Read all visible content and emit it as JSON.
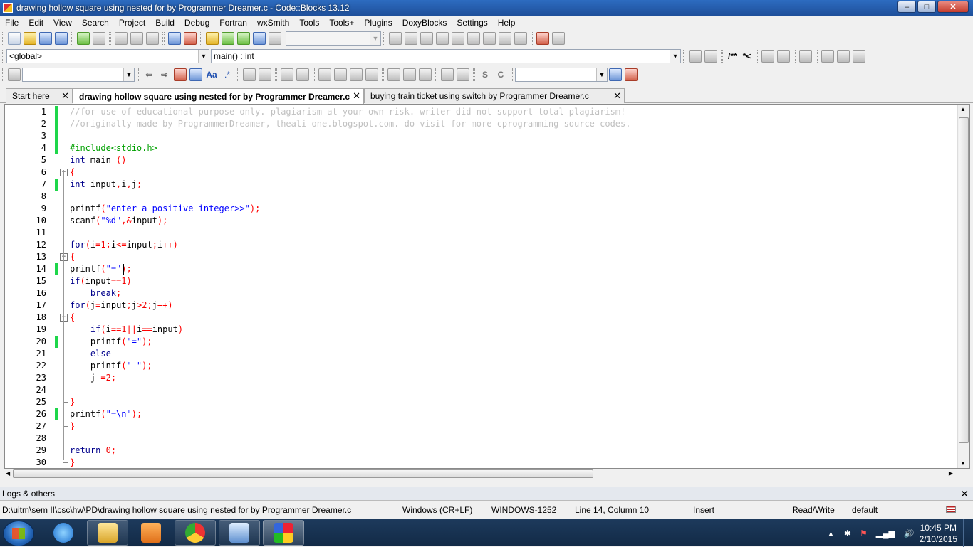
{
  "window": {
    "title": "drawing hollow square using nested for by Programmer Dreamer.c - Code::Blocks 13.12",
    "minimize_glyph": "–",
    "maximize_glyph": "□",
    "close_glyph": "✕"
  },
  "menu": [
    "File",
    "Edit",
    "View",
    "Search",
    "Project",
    "Build",
    "Debug",
    "Fortran",
    "wxSmith",
    "Tools",
    "Tools+",
    "Plugins",
    "DoxyBlocks",
    "Settings",
    "Help"
  ],
  "toolbar2": {
    "scope": "<global>",
    "function": "main() : int",
    "doxy_comment": "/**",
    "doxy_line": "*<"
  },
  "toolbar3": {
    "search_value": "",
    "aa_label": "Aa",
    "regex_label": ".*",
    "s_label": "S",
    "c_label": "C"
  },
  "tabs": [
    {
      "label": "Start here",
      "active": false
    },
    {
      "label": "drawing hollow square using nested for by Programmer Dreamer.c",
      "active": true
    },
    {
      "label": "buying train ticket using switch by Programmer Dreamer.c",
      "active": false
    }
  ],
  "tab_close_glyph": "✕",
  "editor": {
    "lines": [
      {
        "n": "1",
        "text": "//for use of educational purpose only. plagiarism at your own risk. writer did not support total plagiarism!",
        "kind": "comment",
        "changed": true
      },
      {
        "n": "2",
        "text": "//originally made by ProgrammerDreamer, theali-one.blogspot.com. do visit for more cprogramming source codes.",
        "kind": "comment",
        "changed": true
      },
      {
        "n": "3",
        "text": "",
        "kind": "plain",
        "changed": true
      },
      {
        "n": "4",
        "text": "#include<stdio.h>",
        "kind": "preproc",
        "changed": true
      },
      {
        "n": "5",
        "text": "int main ()",
        "kind": "code"
      },
      {
        "n": "6",
        "text": "{",
        "kind": "code",
        "fold": "open"
      },
      {
        "n": "7",
        "text": "int input,i,j;",
        "kind": "code",
        "changed": true
      },
      {
        "n": "8",
        "text": "",
        "kind": "plain"
      },
      {
        "n": "9",
        "text": "printf(\"enter a positive integer>>\");",
        "kind": "code"
      },
      {
        "n": "10",
        "text": "scanf(\"%d\",&input);",
        "kind": "code"
      },
      {
        "n": "11",
        "text": "",
        "kind": "plain"
      },
      {
        "n": "12",
        "text": "for(i=1;i<=input;i++)",
        "kind": "code"
      },
      {
        "n": "13",
        "text": "{",
        "kind": "code",
        "fold": "open"
      },
      {
        "n": "14",
        "text": "printf(\"=\");",
        "kind": "code",
        "changed": true
      },
      {
        "n": "15",
        "text": "if(input==1)",
        "kind": "code"
      },
      {
        "n": "16",
        "text": "    break;",
        "kind": "code"
      },
      {
        "n": "17",
        "text": "for(j=input;j>2;j++)",
        "kind": "code"
      },
      {
        "n": "18",
        "text": "{",
        "kind": "code",
        "fold": "open"
      },
      {
        "n": "19",
        "text": "    if(i==1||i==input)",
        "kind": "code"
      },
      {
        "n": "20",
        "text": "    printf(\"=\");",
        "kind": "code",
        "changed": true
      },
      {
        "n": "21",
        "text": "    else",
        "kind": "code"
      },
      {
        "n": "22",
        "text": "    printf(\" \");",
        "kind": "code"
      },
      {
        "n": "23",
        "text": "    j-=2;",
        "kind": "code"
      },
      {
        "n": "24",
        "text": "",
        "kind": "plain"
      },
      {
        "n": "25",
        "text": "}",
        "kind": "code",
        "fold": "end"
      },
      {
        "n": "26",
        "text": "printf(\"=\\n\");",
        "kind": "code",
        "changed": true
      },
      {
        "n": "27",
        "text": "}",
        "kind": "code",
        "fold": "end"
      },
      {
        "n": "28",
        "text": "",
        "kind": "plain"
      },
      {
        "n": "29",
        "text": "return 0;",
        "kind": "code"
      },
      {
        "n": "30",
        "text": "}",
        "kind": "code",
        "fold": "end"
      }
    ],
    "keywords": [
      "int",
      "for",
      "if",
      "else",
      "break",
      "return"
    ],
    "colors": {
      "comment": "#c0c0c0",
      "preproc": "#00a000",
      "keyword": "#00008b",
      "string": "#0000ff",
      "number": "#f00000",
      "operator": "#ff0000",
      "change_bar": "#1ed64a"
    },
    "scroll_up": "▲",
    "scroll_down": "▼",
    "scroll_left": "◀",
    "scroll_right": "▶"
  },
  "logs": {
    "label": "Logs & others",
    "close_glyph": "✕"
  },
  "status": {
    "path": "D:\\uitm\\sem II\\csc\\hw\\PD\\drawing hollow square using nested for by Programmer Dreamer.c",
    "eol": "Windows (CR+LF)",
    "encoding": "WINDOWS-1252",
    "position": "Line 14, Column 10",
    "mode": "Insert",
    "access": "Read/Write",
    "lexer": "default"
  },
  "taskbar": {
    "time": "10:45 PM",
    "date": "2/10/2015",
    "tray_arrow": "▲"
  }
}
